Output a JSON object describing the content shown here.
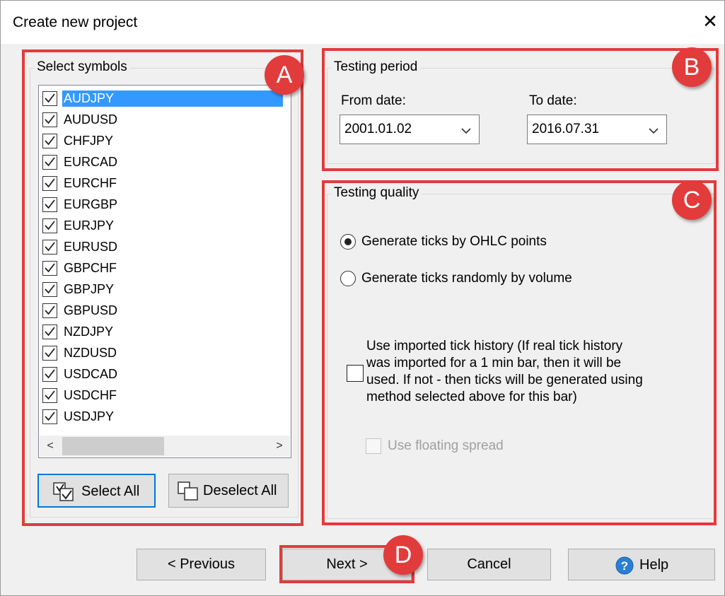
{
  "window": {
    "title": "Create new project",
    "close_symbol": "✕"
  },
  "symbols": {
    "legend": "Select symbols",
    "items": [
      {
        "label": "AUDJPY",
        "checked": true,
        "selected": true
      },
      {
        "label": "AUDUSD",
        "checked": true
      },
      {
        "label": "CHFJPY",
        "checked": true
      },
      {
        "label": "EURCAD",
        "checked": true
      },
      {
        "label": "EURCHF",
        "checked": true
      },
      {
        "label": "EURGBP",
        "checked": true
      },
      {
        "label": "EURJPY",
        "checked": true
      },
      {
        "label": "EURUSD",
        "checked": true
      },
      {
        "label": "GBPCHF",
        "checked": true
      },
      {
        "label": "GBPJPY",
        "checked": true
      },
      {
        "label": "GBPUSD",
        "checked": true
      },
      {
        "label": "NZDJPY",
        "checked": true
      },
      {
        "label": "NZDUSD",
        "checked": true
      },
      {
        "label": "USDCAD",
        "checked": true
      },
      {
        "label": "USDCHF",
        "checked": true
      },
      {
        "label": "USDJPY",
        "checked": true
      }
    ],
    "scroll_left": "<",
    "scroll_right": ">",
    "select_all_label": "Select All",
    "deselect_all_label": "Deselect All"
  },
  "period": {
    "legend": "Testing period",
    "from_label": "From date:",
    "from_value": "2001.01.02",
    "to_label": "To date:",
    "to_value": "2016.07.31"
  },
  "quality": {
    "legend": "Testing quality",
    "option_ohlc": "Generate ticks by OHLC points",
    "option_random": "Generate ticks randomly by volume",
    "selected_option": "option_ohlc",
    "tick_history_lines": [
      "Use imported tick history (If real tick history",
      "was imported for a 1 min bar, then it will be",
      "used. If not - then ticks will be generated using",
      "method selected above for this bar)"
    ],
    "tick_history_checked": false,
    "floating_spread_label": "Use floating spread",
    "floating_spread_enabled": false
  },
  "footer": {
    "previous_label": "< Previous",
    "next_label": "Next >",
    "cancel_label": "Cancel",
    "help_label": "Help"
  },
  "badges": {
    "a": "A",
    "b": "B",
    "c": "C",
    "d": "D"
  },
  "colors": {
    "annotation": "#e23b3b",
    "selection": "#3399ff",
    "focus": "#0078d7"
  }
}
